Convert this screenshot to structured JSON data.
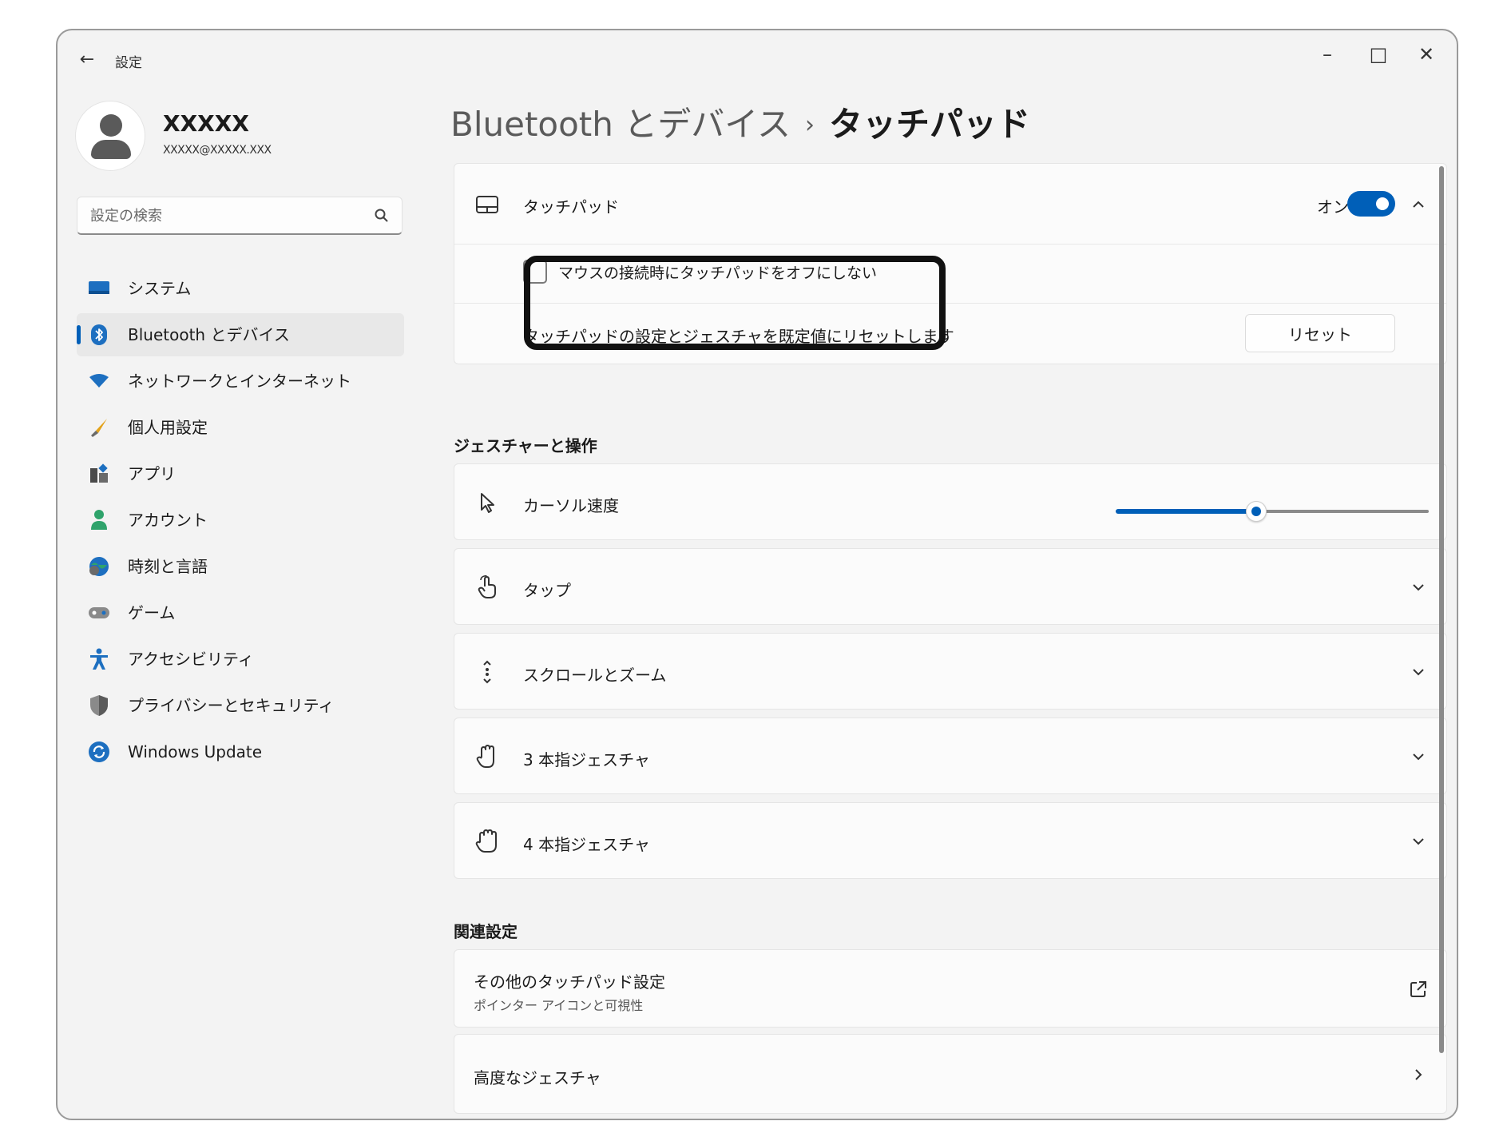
{
  "window": {
    "back": "←",
    "title": "設定",
    "controls": {
      "minimize": "–",
      "maximize": "□",
      "close": "✕"
    }
  },
  "profile": {
    "name": "XXXXX",
    "email": "XXXXX@XXXXX.XXX"
  },
  "search": {
    "placeholder": "設定の検索"
  },
  "sidebar": {
    "items": [
      {
        "label": "システム",
        "icon": "system-icon",
        "active": false
      },
      {
        "label": "Bluetooth とデバイス",
        "icon": "bluetooth-icon",
        "active": true
      },
      {
        "label": "ネットワークとインターネット",
        "icon": "wifi-icon",
        "active": false
      },
      {
        "label": "個人用設定",
        "icon": "brush-icon",
        "active": false
      },
      {
        "label": "アプリ",
        "icon": "apps-icon",
        "active": false
      },
      {
        "label": "アカウント",
        "icon": "account-icon",
        "active": false
      },
      {
        "label": "時刻と言語",
        "icon": "globe-clock-icon",
        "active": false
      },
      {
        "label": "ゲーム",
        "icon": "gamepad-icon",
        "active": false
      },
      {
        "label": "アクセシビリティ",
        "icon": "accessibility-icon",
        "active": false
      },
      {
        "label": "プライバシーとセキュリティ",
        "icon": "shield-icon",
        "active": false
      },
      {
        "label": "Windows Update",
        "icon": "windows-update-icon",
        "active": false
      }
    ]
  },
  "breadcrumb": {
    "parent": "Bluetooth とデバイス",
    "separator": "›",
    "current": "タッチパッド"
  },
  "touchpad": {
    "label": "タッチパッド",
    "toggle_label": "オン",
    "toggle_on": true,
    "checkbox_label": "マウスの接続時にタッチパッドをオフにしない",
    "checkbox_checked": false,
    "reset_text": "タッチパッドの設定とジェスチャを既定値にリセットします",
    "reset_button": "リセット"
  },
  "gestures": {
    "title": "ジェスチャーと操作",
    "cursor_speed": {
      "label": "カーソル速度",
      "value": 0.45
    },
    "rows": [
      {
        "label": "タップ",
        "icon": "tap-hand-icon"
      },
      {
        "label": "スクロールとズーム",
        "icon": "scroll-icon"
      },
      {
        "label": "3 本指ジェスチャ",
        "icon": "three-finger-icon"
      },
      {
        "label": "4 本指ジェスチャ",
        "icon": "four-finger-icon"
      }
    ]
  },
  "related": {
    "title": "関連設定",
    "more": {
      "label": "その他のタッチパッド設定",
      "sub": "ポインター アイコンと可視性"
    },
    "advanced": {
      "label": "高度なジェスチャ"
    }
  },
  "colors": {
    "accent": "#005fb8",
    "background": "#f3f3f3",
    "card": "#fbfbfb"
  }
}
